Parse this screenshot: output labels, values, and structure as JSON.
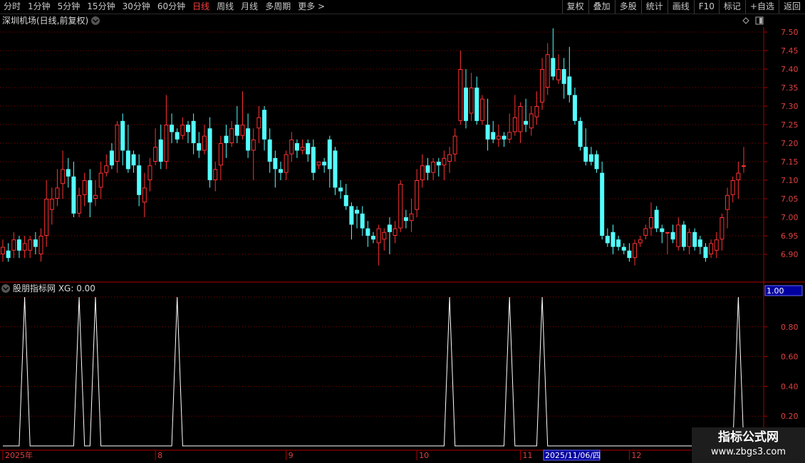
{
  "toolbar": {
    "periods": [
      {
        "label": "分时",
        "active": false
      },
      {
        "label": "1分钟",
        "active": false
      },
      {
        "label": "5分钟",
        "active": false
      },
      {
        "label": "15分钟",
        "active": false
      },
      {
        "label": "30分钟",
        "active": false
      },
      {
        "label": "60分钟",
        "active": false
      },
      {
        "label": "日线",
        "active": true
      },
      {
        "label": "周线",
        "active": false
      },
      {
        "label": "月线",
        "active": false
      },
      {
        "label": "多周期",
        "active": false
      },
      {
        "label": "更多 >",
        "active": false
      }
    ],
    "tools": [
      "复权",
      "叠加",
      "多股",
      "统计",
      "画线",
      "F10",
      "标记",
      "+自选",
      "返回"
    ]
  },
  "main_panel": {
    "title": "深圳机场(日线,前复权)",
    "price_ticks": [
      "7.50",
      "7.45",
      "7.40",
      "7.35",
      "7.30",
      "7.25",
      "7.20",
      "7.15",
      "7.10",
      "7.05",
      "7.00",
      "6.95",
      "6.90"
    ]
  },
  "indicator_panel": {
    "title": "股朋指标网 XG: 0.00",
    "current_value": "1.00",
    "ticks": [
      "0.80",
      "0.60",
      "0.40",
      "0.20"
    ]
  },
  "date_axis": {
    "labels": [
      "2025年",
      "8",
      "9",
      "10",
      "11",
      "12"
    ],
    "cursor_date": "2025/11/06/四"
  },
  "watermark": {
    "title": "指标公式网",
    "url": "www.zbgs3.com"
  },
  "colors": {
    "up": "#ff3232",
    "down": "#54ffff",
    "grid": "#8b0000",
    "axis": "#b00000",
    "signal": "#ffffff"
  },
  "chart_data": {
    "type": "candlestick",
    "ylim": [
      6.85,
      7.52
    ],
    "candles": [
      [
        6.9,
        6.92,
        6.88,
        6.94
      ],
      [
        6.91,
        6.89,
        6.88,
        6.93
      ],
      [
        6.91,
        6.94,
        6.89,
        6.96
      ],
      [
        6.94,
        6.91,
        6.89,
        6.95
      ],
      [
        6.91,
        6.93,
        6.89,
        6.95
      ],
      [
        6.91,
        6.94,
        6.89,
        6.95
      ],
      [
        6.94,
        6.92,
        6.9,
        6.96
      ],
      [
        6.9,
        6.95,
        6.88,
        6.97
      ],
      [
        6.95,
        7.05,
        6.92,
        7.1
      ],
      [
        7.02,
        7.05,
        6.98,
        7.08
      ],
      [
        7.05,
        7.08,
        7.03,
        7.13
      ],
      [
        7.09,
        7.13,
        7.05,
        7.18
      ],
      [
        7.13,
        7.11,
        7.08,
        7.16
      ],
      [
        7.11,
        7.01,
        7.0,
        7.15
      ],
      [
        7.01,
        7.06,
        7.0,
        7.08
      ],
      [
        7.06,
        7.1,
        7.03,
        7.12
      ],
      [
        7.1,
        7.04,
        7.0,
        7.13
      ],
      [
        7.05,
        7.06,
        7.03,
        7.1
      ],
      [
        7.08,
        7.12,
        7.05,
        7.15
      ],
      [
        7.12,
        7.14,
        7.11,
        7.17
      ],
      [
        7.18,
        7.14,
        7.13,
        7.2
      ],
      [
        7.15,
        7.25,
        7.12,
        7.26
      ],
      [
        7.26,
        7.18,
        7.14,
        7.28
      ],
      [
        7.18,
        7.13,
        7.12,
        7.25
      ],
      [
        7.17,
        7.14,
        7.12,
        7.18
      ],
      [
        7.14,
        7.06,
        7.03,
        7.17
      ],
      [
        7.04,
        7.08,
        7.0,
        7.12
      ],
      [
        7.1,
        7.14,
        7.07,
        7.16
      ],
      [
        7.15,
        7.19,
        7.14,
        7.24
      ],
      [
        7.21,
        7.15,
        7.13,
        7.25
      ],
      [
        7.15,
        7.25,
        7.13,
        7.33
      ],
      [
        7.25,
        7.23,
        7.2,
        7.28
      ],
      [
        7.23,
        7.21,
        7.2,
        7.24
      ],
      [
        7.22,
        7.25,
        7.21,
        7.27
      ],
      [
        7.25,
        7.23,
        7.2,
        7.26
      ],
      [
        7.26,
        7.2,
        7.17,
        7.28
      ],
      [
        7.2,
        7.18,
        7.16,
        7.23
      ],
      [
        7.18,
        7.22,
        7.17,
        7.25
      ],
      [
        7.24,
        7.1,
        7.08,
        7.27
      ],
      [
        7.1,
        7.13,
        7.07,
        7.15
      ],
      [
        7.14,
        7.2,
        7.1,
        7.22
      ],
      [
        7.22,
        7.2,
        7.16,
        7.25
      ],
      [
        7.2,
        7.24,
        7.19,
        7.26
      ],
      [
        7.25,
        7.22,
        7.2,
        7.3
      ],
      [
        7.22,
        7.25,
        7.21,
        7.34
      ],
      [
        7.24,
        7.18,
        7.16,
        7.28
      ],
      [
        7.18,
        7.21,
        7.1,
        7.24
      ],
      [
        7.24,
        7.27,
        7.2,
        7.3
      ],
      [
        7.29,
        7.21,
        7.18,
        7.3
      ],
      [
        7.21,
        7.15,
        7.12,
        7.24
      ],
      [
        7.16,
        7.13,
        7.08,
        7.18
      ],
      [
        7.13,
        7.12,
        7.1,
        7.15
      ],
      [
        7.12,
        7.17,
        7.1,
        7.18
      ],
      [
        7.17,
        7.21,
        7.15,
        7.23
      ],
      [
        7.2,
        7.18,
        7.16,
        7.21
      ],
      [
        7.18,
        7.19,
        7.17,
        7.21
      ],
      [
        7.2,
        7.17,
        7.15,
        7.21
      ],
      [
        7.19,
        7.12,
        7.1,
        7.21
      ],
      [
        7.14,
        7.15,
        7.13,
        7.15
      ],
      [
        7.15,
        7.14,
        7.12,
        7.16
      ],
      [
        7.21,
        7.13,
        7.08,
        7.22
      ],
      [
        7.18,
        7.08,
        7.06,
        7.19
      ],
      [
        7.08,
        7.07,
        7.05,
        7.1
      ],
      [
        7.06,
        7.03,
        7.02,
        7.09
      ],
      [
        7.03,
        6.98,
        6.94,
        7.04
      ],
      [
        7.02,
        7.01,
        6.97,
        7.03
      ],
      [
        7.01,
        6.97,
        6.95,
        7.03
      ],
      [
        6.97,
        6.95,
        6.92,
        6.99
      ],
      [
        6.95,
        6.94,
        6.93,
        6.96
      ],
      [
        6.93,
        6.97,
        6.87,
        6.98
      ],
      [
        6.94,
        6.96,
        6.91,
        6.97
      ],
      [
        6.98,
        6.96,
        6.9,
        7.0
      ],
      [
        6.95,
        6.97,
        6.93,
        6.99
      ],
      [
        6.97,
        7.09,
        6.96,
        7.1
      ],
      [
        7.0,
        6.99,
        6.97,
        7.02
      ],
      [
        6.99,
        7.01,
        6.96,
        7.05
      ],
      [
        7.02,
        7.1,
        7.0,
        7.13
      ],
      [
        7.1,
        7.14,
        7.08,
        7.17
      ],
      [
        7.14,
        7.12,
        7.1,
        7.16
      ],
      [
        7.12,
        7.15,
        7.1,
        7.16
      ],
      [
        7.15,
        7.14,
        7.11,
        7.16
      ],
      [
        7.14,
        7.16,
        7.1,
        7.18
      ],
      [
        7.15,
        7.17,
        7.12,
        7.19
      ],
      [
        7.17,
        7.22,
        7.15,
        7.24
      ],
      [
        7.26,
        7.4,
        7.25,
        7.45
      ],
      [
        7.35,
        7.26,
        7.24,
        7.4
      ],
      [
        7.28,
        7.35,
        7.26,
        7.39
      ],
      [
        7.35,
        7.26,
        7.25,
        7.38
      ],
      [
        7.26,
        7.32,
        7.25,
        7.33
      ],
      [
        7.25,
        7.21,
        7.18,
        7.32
      ],
      [
        7.23,
        7.21,
        7.2,
        7.26
      ],
      [
        7.21,
        7.22,
        7.19,
        7.25
      ],
      [
        7.22,
        7.21,
        7.19,
        7.23
      ],
      [
        7.21,
        7.23,
        7.2,
        7.28
      ],
      [
        7.23,
        7.27,
        7.22,
        7.33
      ],
      [
        7.23,
        7.3,
        7.2,
        7.31
      ],
      [
        7.26,
        7.25,
        7.23,
        7.32
      ],
      [
        7.24,
        7.28,
        7.22,
        7.3
      ],
      [
        7.27,
        7.3,
        7.25,
        7.34
      ],
      [
        7.31,
        7.4,
        7.29,
        7.43
      ],
      [
        7.35,
        7.44,
        7.33,
        7.47
      ],
      [
        7.43,
        7.38,
        7.37,
        7.51
      ],
      [
        7.37,
        7.4,
        7.36,
        7.44
      ],
      [
        7.4,
        7.36,
        7.32,
        7.43
      ],
      [
        7.38,
        7.33,
        7.31,
        7.46
      ],
      [
        7.33,
        7.26,
        7.25,
        7.35
      ],
      [
        7.26,
        7.19,
        7.18,
        7.27
      ],
      [
        7.19,
        7.15,
        7.14,
        7.24
      ],
      [
        7.17,
        7.15,
        7.14,
        7.19
      ],
      [
        7.17,
        7.13,
        7.12,
        7.18
      ],
      [
        7.12,
        6.95,
        6.94,
        7.15
      ],
      [
        6.95,
        6.93,
        6.92,
        6.97
      ],
      [
        6.96,
        6.92,
        6.9,
        6.98
      ],
      [
        6.94,
        6.92,
        6.91,
        6.95
      ],
      [
        6.92,
        6.91,
        6.9,
        6.93
      ],
      [
        6.91,
        6.89,
        6.88,
        6.93
      ],
      [
        6.89,
        6.93,
        6.87,
        6.94
      ],
      [
        6.93,
        6.94,
        6.92,
        6.95
      ],
      [
        6.95,
        6.97,
        6.94,
        6.98
      ],
      [
        6.97,
        7.0,
        6.95,
        7.04
      ],
      [
        7.02,
        6.97,
        6.96,
        7.03
      ],
      [
        6.97,
        6.96,
        6.93,
        6.98
      ],
      [
        6.96,
        6.96,
        6.9,
        6.96
      ],
      [
        6.96,
        6.94,
        6.93,
        6.98
      ],
      [
        6.92,
        6.98,
        6.91,
        7.0
      ],
      [
        6.98,
        6.92,
        6.91,
        6.99
      ],
      [
        6.92,
        6.96,
        6.9,
        6.97
      ],
      [
        6.96,
        6.92,
        6.91,
        6.97
      ],
      [
        6.94,
        6.92,
        6.9,
        6.95
      ],
      [
        6.92,
        6.89,
        6.88,
        6.93
      ],
      [
        6.9,
        6.93,
        6.89,
        6.94
      ],
      [
        6.91,
        6.94,
        6.89,
        6.96
      ],
      [
        6.94,
        7.0,
        6.91,
        7.01
      ],
      [
        7.02,
        7.06,
        6.97,
        7.08
      ],
      [
        7.06,
        7.1,
        7.04,
        7.11
      ],
      [
        7.1,
        7.12,
        7.05,
        7.15
      ],
      [
        7.14,
        7.14,
        7.12,
        7.19
      ]
    ],
    "indicator": {
      "ylim": [
        0,
        1.0
      ],
      "signal_bars": [
        4,
        14,
        17,
        32,
        82,
        93,
        99,
        135
      ]
    }
  }
}
